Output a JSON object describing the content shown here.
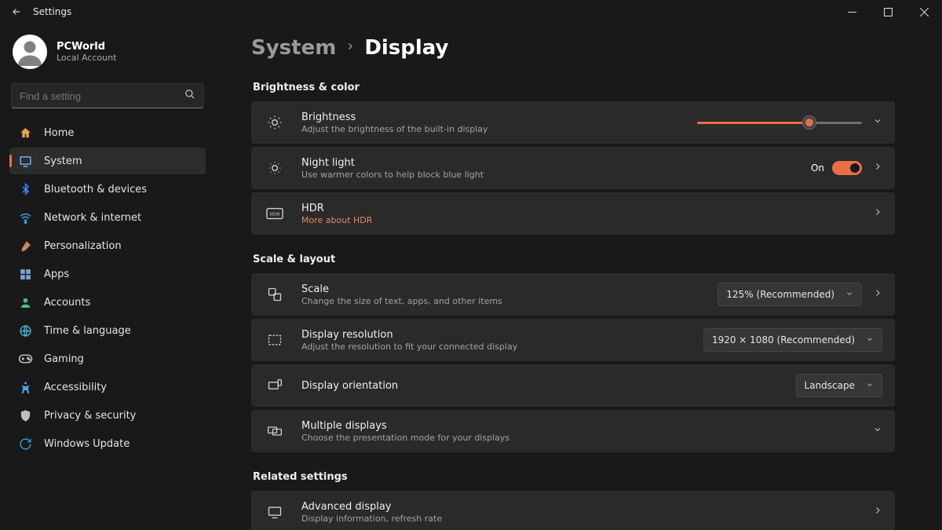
{
  "titlebar": {
    "title": "Settings"
  },
  "user": {
    "name": "PCWorld",
    "sub": "Local Account"
  },
  "search": {
    "placeholder": "Find a setting"
  },
  "nav": [
    {
      "label": "Home",
      "icon": "home",
      "color": "#e8a24a"
    },
    {
      "label": "System",
      "icon": "system",
      "color": "#72b6ff"
    },
    {
      "label": "Bluetooth & devices",
      "icon": "bluetooth",
      "color": "#3a86ff"
    },
    {
      "label": "Network & internet",
      "icon": "wifi",
      "color": "#29b6f6"
    },
    {
      "label": "Personalization",
      "icon": "brush",
      "color": "#c88b5a"
    },
    {
      "label": "Apps",
      "icon": "apps",
      "color": "#7aa7d6"
    },
    {
      "label": "Accounts",
      "icon": "person",
      "color": "#4bc27b"
    },
    {
      "label": "Time & language",
      "icon": "globe",
      "color": "#4bb3d6"
    },
    {
      "label": "Gaming",
      "icon": "gamepad",
      "color": "#bdbdbd"
    },
    {
      "label": "Accessibility",
      "icon": "accessibility",
      "color": "#4aa6e0"
    },
    {
      "label": "Privacy & security",
      "icon": "shield",
      "color": "#bfbfbf"
    },
    {
      "label": "Windows Update",
      "icon": "update",
      "color": "#2f9fe0"
    }
  ],
  "nav_active_index": 1,
  "breadcrumb": {
    "parent": "System",
    "current": "Display"
  },
  "sections": {
    "brightness": {
      "title": "Brightness & color",
      "items": {
        "brightness": {
          "title": "Brightness",
          "sub": "Adjust the brightness of the built-in display",
          "value_pct": 68
        },
        "nightlight": {
          "title": "Night light",
          "sub": "Use warmer colors to help block blue light",
          "state_label": "On",
          "enabled": true
        },
        "hdr": {
          "title": "HDR",
          "link": "More about HDR"
        }
      }
    },
    "scale": {
      "title": "Scale & layout",
      "items": {
        "scale": {
          "title": "Scale",
          "sub": "Change the size of text, apps, and other items",
          "value": "125% (Recommended)"
        },
        "resolution": {
          "title": "Display resolution",
          "sub": "Adjust the resolution to fit your connected display",
          "value": "1920 × 1080 (Recommended)"
        },
        "orientation": {
          "title": "Display orientation",
          "value": "Landscape"
        },
        "multiple": {
          "title": "Multiple displays",
          "sub": "Choose the presentation mode for your displays"
        }
      }
    },
    "related": {
      "title": "Related settings",
      "items": {
        "advanced": {
          "title": "Advanced display",
          "sub": "Display information, refresh rate"
        }
      }
    }
  }
}
